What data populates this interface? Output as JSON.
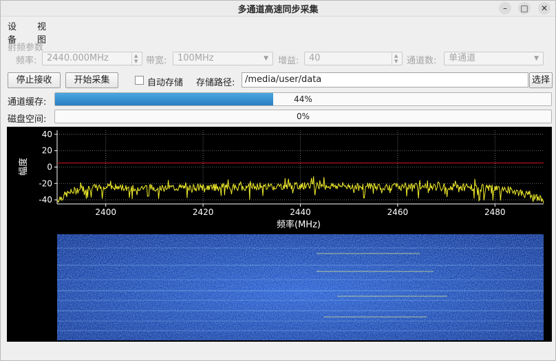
{
  "window": {
    "title": "多通道高速同步采集"
  },
  "menu": [
    "设备",
    "视图"
  ],
  "rf": {
    "section_label": "射频参数",
    "freq_label": "频率:",
    "freq_value": "2440.000MHz",
    "bw_label": "带宽:",
    "bw_value": "100MHz",
    "gain_label": "增益:",
    "gain_value": "40",
    "channels_label": "通道数:",
    "channels_value": "单通道"
  },
  "controls": {
    "stop_label": "停止接收",
    "start_label": "开始采集",
    "autosave_label": "自动存储",
    "autosave_checked": false,
    "path_label": "存储路径:",
    "path_value": "/media/user/data",
    "choose_label": "选择"
  },
  "status": {
    "buffer_label": "通道缓存:",
    "buffer_value": 44,
    "buffer_text": "44%",
    "disk_label": "磁盘空间:",
    "disk_value": 0,
    "disk_text": "0%"
  },
  "colors": {
    "trace": "#f2ee2c",
    "threshold": "#c0141c",
    "progress": "#2a7fc2",
    "waterfall_bg": "#1a3fa6"
  },
  "chart_data": {
    "type": "line",
    "title": "",
    "xlabel": "频率(MHz)",
    "ylabel": "幅度",
    "xlim": [
      2390,
      2490
    ],
    "ylim": [
      -45,
      45
    ],
    "xticks": [
      2400,
      2420,
      2440,
      2460,
      2480
    ],
    "yticks": [
      40,
      20,
      0,
      -20,
      -40
    ],
    "grid": true,
    "threshold": 5,
    "spectrum": {
      "x": [
        2390,
        2392,
        2394,
        2396,
        2400,
        2410,
        2420,
        2430,
        2440,
        2450,
        2460,
        2470,
        2480,
        2484,
        2486,
        2488,
        2490
      ],
      "y": [
        -40,
        -33,
        -28,
        -26,
        -25,
        -25,
        -25,
        -24,
        -23,
        -23,
        -24,
        -24,
        -26,
        -29,
        -33,
        -37,
        -40
      ]
    },
    "waterfall": {
      "type": "heatmap",
      "xlim": [
        2390,
        2490
      ]
    }
  }
}
